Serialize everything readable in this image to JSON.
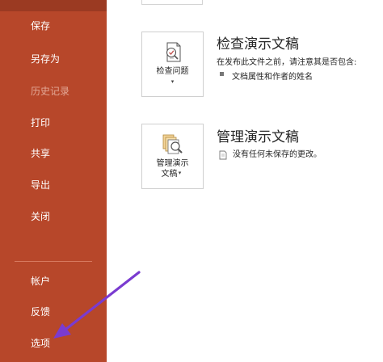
{
  "sidebar": {
    "items": [
      {
        "label": "保存",
        "disabled": false
      },
      {
        "label": "另存为",
        "disabled": false
      },
      {
        "label": "历史记录",
        "disabled": true
      },
      {
        "label": "打印",
        "disabled": false
      },
      {
        "label": "共享",
        "disabled": false
      },
      {
        "label": "导出",
        "disabled": false
      },
      {
        "label": "关闭",
        "disabled": false
      }
    ],
    "bottom_items": [
      {
        "label": "帐户"
      },
      {
        "label": "反馈"
      },
      {
        "label": "选项"
      }
    ],
    "color": "#b7472a"
  },
  "inspect": {
    "tile_label": "检查问题",
    "title": "检查演示文稿",
    "description": "在发布此文件之前，请注意其是否包含:",
    "bullets": [
      "文档属性和作者的姓名"
    ]
  },
  "manage": {
    "tile_label_line1": "管理演示",
    "tile_label_line2": "文稿",
    "title": "管理演示文稿",
    "status": "没有任何未保存的更改。"
  },
  "annotation": {
    "color": "#7a3bd0"
  }
}
